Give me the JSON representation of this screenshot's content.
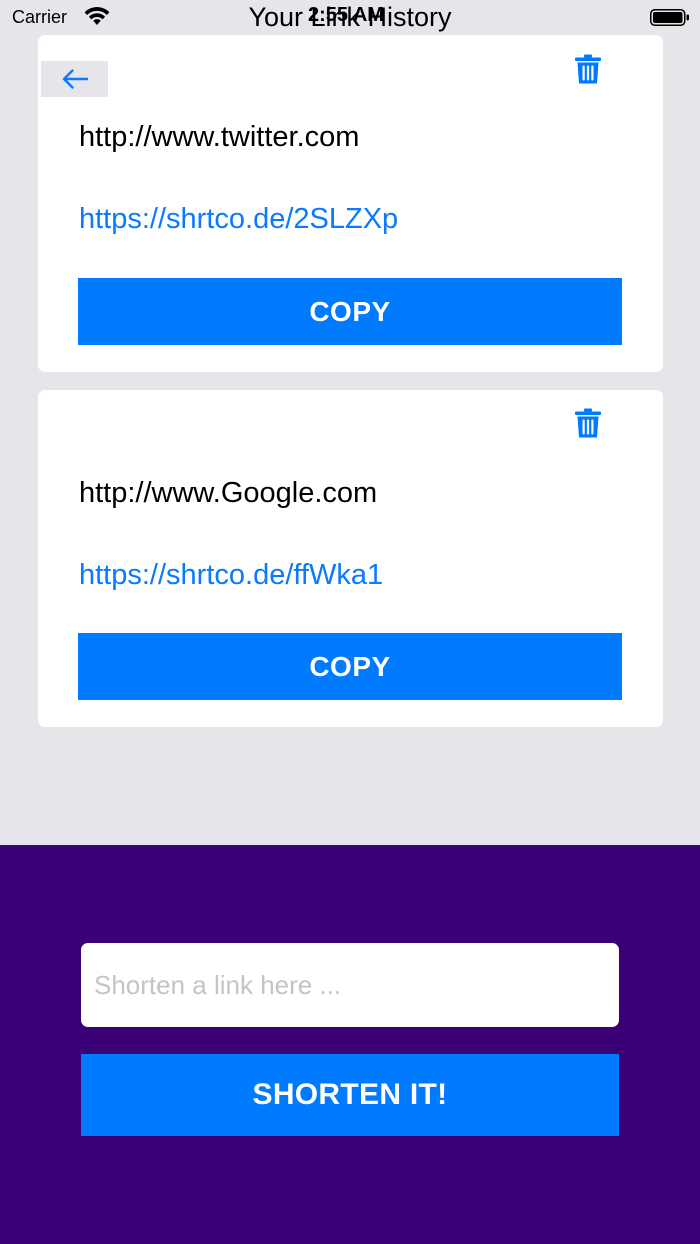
{
  "status_bar": {
    "carrier": "Carrier",
    "time": "2:55 AM",
    "icons": [
      "wifi-icon",
      "battery-icon"
    ]
  },
  "nav": {
    "title": "Your Link History",
    "back_icon": "arrow-left-icon"
  },
  "history": [
    {
      "original_url": "http://www.twitter.com",
      "short_url": "https://shrtco.de/2SLZXp",
      "copy_label": "COPY",
      "delete_icon": "trash-icon"
    },
    {
      "original_url": "http://www.Google.com",
      "short_url": "https://shrtco.de/ffWka1",
      "copy_label": "COPY",
      "delete_icon": "trash-icon"
    }
  ],
  "shorten_form": {
    "input_value": "",
    "input_placeholder": "Shorten a link here ...",
    "button_label": "SHORTEN IT!"
  },
  "colors": {
    "accent": "#007aff",
    "link": "#0a7aff",
    "panel": "#3b0075",
    "background": "#e5e5ea"
  }
}
